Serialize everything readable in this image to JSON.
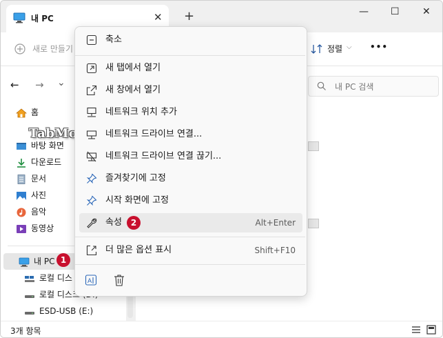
{
  "window": {
    "tab_title": "내 PC",
    "tab_close": "✕",
    "new_tab": "+",
    "minimize": "—",
    "maximize": "☐",
    "close": "✕"
  },
  "toolbar": {
    "new_label": "새로 만들기",
    "sort_label": "정렬",
    "sort_chevron": "⌵",
    "more": "•••"
  },
  "nav": {
    "back": "←",
    "forward": "→",
    "down": "⌄",
    "search_placeholder": "내 PC 검색"
  },
  "sidebar": {
    "items": [
      {
        "label": "홈",
        "icon": "home-icon"
      },
      {
        "label": "바탕 화면",
        "icon": "desktop-icon"
      },
      {
        "label": "다운로드",
        "icon": "download-icon"
      },
      {
        "label": "문서",
        "icon": "document-icon"
      },
      {
        "label": "사진",
        "icon": "pictures-icon"
      },
      {
        "label": "음악",
        "icon": "music-icon"
      },
      {
        "label": "동영상",
        "icon": "video-icon"
      },
      {
        "label": "내 PC",
        "icon": "pc-icon"
      },
      {
        "label": "로컬 디스",
        "icon": "drive-icon"
      },
      {
        "label": "로컬 디스크 (D:)",
        "icon": "drive-icon"
      },
      {
        "label": "ESD-USB (E:)",
        "icon": "usb-drive-icon"
      }
    ]
  },
  "status": {
    "count": "3개 항목"
  },
  "context_menu": {
    "items": [
      {
        "label": "축소",
        "shortcut": "",
        "icon": "collapse-icon"
      },
      {
        "label": "새 탭에서 열기",
        "shortcut": "",
        "icon": "open-new-tab-icon"
      },
      {
        "label": "새 창에서 열기",
        "shortcut": "",
        "icon": "open-new-window-icon"
      },
      {
        "label": "네트워크 위치 추가",
        "shortcut": "",
        "icon": "network-location-icon"
      },
      {
        "label": "네트워크 드라이브 연결...",
        "shortcut": "",
        "icon": "map-network-drive-icon"
      },
      {
        "label": "네트워크 드라이브 연결 끊기...",
        "shortcut": "",
        "icon": "disconnect-network-drive-icon"
      },
      {
        "label": "즐겨찾기에 고정",
        "shortcut": "",
        "icon": "pin-icon"
      },
      {
        "label": "시작 화면에 고정",
        "shortcut": "",
        "icon": "pin-start-icon"
      },
      {
        "label": "속성",
        "shortcut": "Alt+Enter",
        "icon": "wrench-icon"
      },
      {
        "label": "더 많은 옵션 표시",
        "shortcut": "Shift+F10",
        "icon": "more-options-icon"
      }
    ]
  },
  "annotations": {
    "badge1": "1",
    "badge2": "2"
  },
  "watermark": "TabMode.com",
  "colors": {
    "badge": "#c8102e",
    "accent": "#0067c0"
  }
}
